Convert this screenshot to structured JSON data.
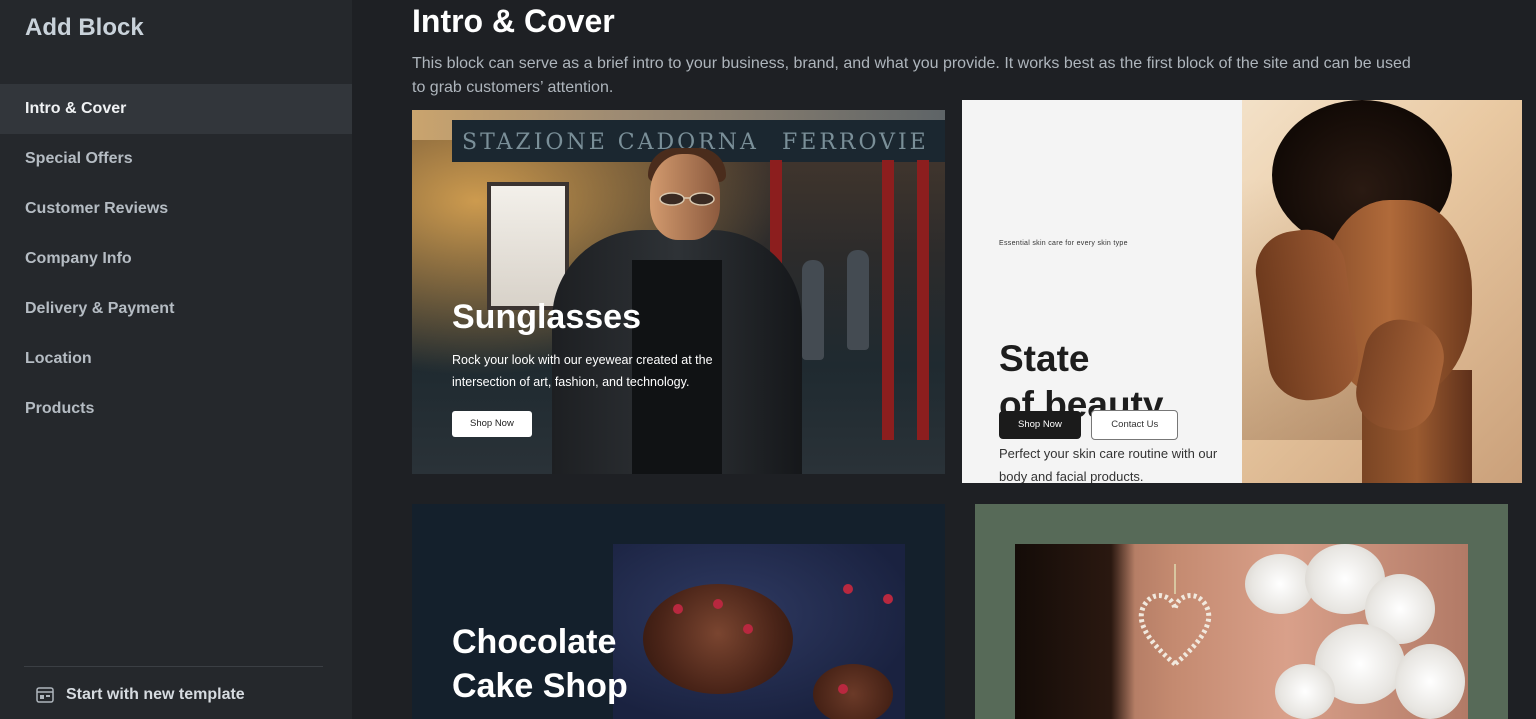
{
  "sidebar": {
    "title": "Add Block",
    "items": [
      {
        "label": "Intro & Cover",
        "active": true
      },
      {
        "label": "Special Offers",
        "active": false
      },
      {
        "label": "Customer Reviews",
        "active": false
      },
      {
        "label": "Company Info",
        "active": false
      },
      {
        "label": "Delivery & Payment",
        "active": false
      },
      {
        "label": "Location",
        "active": false
      },
      {
        "label": "Products",
        "active": false
      }
    ],
    "footer": {
      "label": "Start with new template",
      "icon": "template-icon"
    }
  },
  "main": {
    "title": "Intro & Cover",
    "description": "This block can serve as a brief intro to your business, brand, and what you provide. It works best as the first block of the site and can be used to grab customers’ attention."
  },
  "cards": {
    "sunglasses": {
      "sign_left": "STAZIONE  CADORNA",
      "sign_right": "FERROVIE",
      "title": "Sunglasses",
      "subtitle": "Rock your look with our eyewear created at the intersection of art, fashion, and technology.",
      "button": "Shop Now"
    },
    "beauty": {
      "tagline": "Essential skin care for every skin type",
      "title_line1": "State",
      "title_line2": "of beauty",
      "body": "Perfect your skin care routine with our body and facial products.",
      "button_primary": "Shop Now",
      "button_secondary": "Contact Us"
    },
    "cake": {
      "title_line1": "Chocolate",
      "title_line2": "Cake Shop"
    }
  },
  "colors": {
    "background": "#1e2024",
    "sidebar": "#25282c",
    "sidebar_active": "#32363b",
    "card4_bg": "#576a58"
  }
}
